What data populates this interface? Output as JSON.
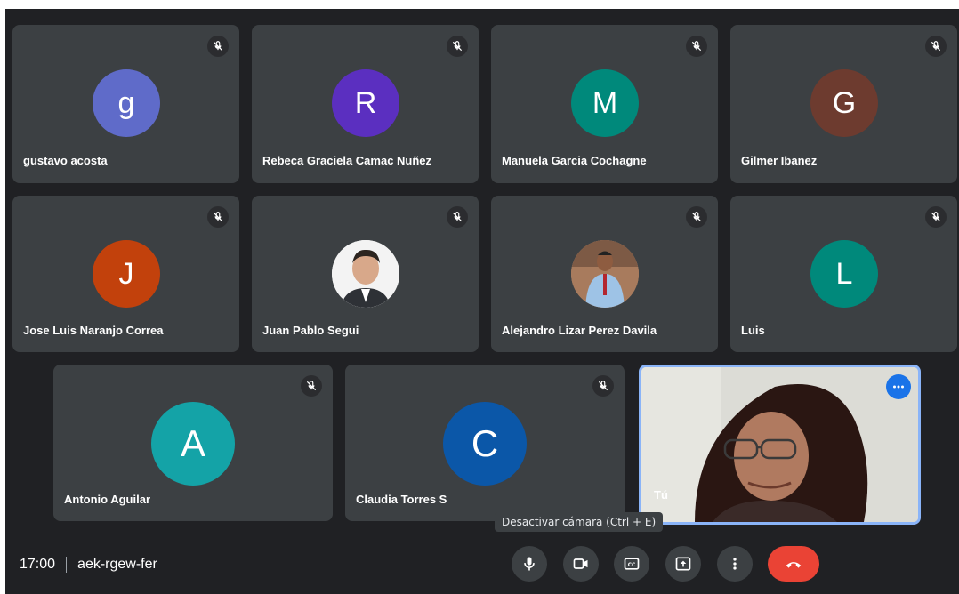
{
  "participants": [
    {
      "name": "gustavo acosta",
      "initial": "g",
      "color": "#5f6bc9"
    },
    {
      "name": "Rebeca Graciela Camac Nuñez",
      "initial": "R",
      "color": "#5b2fc0"
    },
    {
      "name": "Manuela Garcia Cochagne",
      "initial": "M",
      "color": "#00897b"
    },
    {
      "name": "Gilmer Ibanez",
      "initial": "G",
      "color": "#6d3b2f"
    },
    {
      "name": "Jose Luis Naranjo Correa",
      "initial": "J",
      "color": "#c2410c"
    },
    {
      "name": "Juan Pablo Segui",
      "initial": "",
      "color": "#f1f1f1"
    },
    {
      "name": "Alejandro Lizar Perez Davila",
      "initial": "",
      "color": "#8a5a3c"
    },
    {
      "name": "Luis",
      "initial": "L",
      "color": "#00897b"
    },
    {
      "name": "Antonio Aguilar",
      "initial": "A",
      "color": "#14a3a7"
    },
    {
      "name": "Claudia Torres S",
      "initial": "C",
      "color": "#0b57a8"
    }
  ],
  "self": {
    "label": "Tú"
  },
  "bottom_bar": {
    "time": "17:00",
    "meeting_code": "aek-rgew-fer",
    "tooltip": "Desactivar cámara (Ctrl + E)"
  },
  "icons": [
    "mic-off-icon",
    "mic-icon",
    "camera-icon",
    "captions-icon",
    "present-icon",
    "more-vert-icon",
    "hangup-icon",
    "more-horiz-icon"
  ]
}
